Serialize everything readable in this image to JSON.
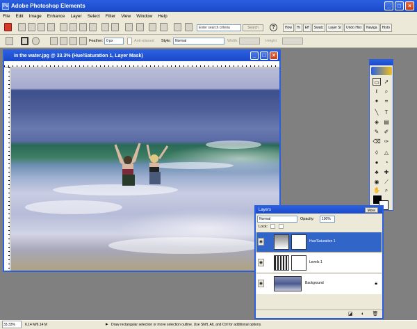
{
  "app": {
    "title": "Adobe Photoshop Elements",
    "icon": "ps-app-icon"
  },
  "window_controls": [
    "minimize-icon",
    "maximize-icon",
    "close-icon"
  ],
  "menu": [
    "File",
    "Edit",
    "Image",
    "Enhance",
    "Layer",
    "Select",
    "Filter",
    "View",
    "Window",
    "Help"
  ],
  "shortcuts": {
    "search_placeholder": "Enter search criteria",
    "search_button": "Search",
    "help_icon": "?",
    "palette_tabs": [
      "How",
      "Hi",
      "Eff",
      "Swatc",
      "Layer St",
      "Undo Hist",
      "Naviga",
      "Histo"
    ]
  },
  "options": {
    "feather_label": "Feather:",
    "feather_value": "0 px",
    "antialias_label": "Anti-aliased",
    "style_label": "Style:",
    "style_value": "Normal",
    "width_label": "Width:",
    "height_label": "Height:"
  },
  "document": {
    "title": "in the water.jpg @ 33.3% (Hue/Saturation 1, Layer Mask)",
    "colors": {
      "sky": "#b9bdd6",
      "sea": "#4d5e97",
      "wave": "#2a6a58",
      "foam": "#c9cde3",
      "sand": "#b0a382"
    }
  },
  "layers": {
    "tab": "Layers",
    "more": "More",
    "blend_mode": "Normal",
    "opacity_label": "Opacity:",
    "opacity_value": "100%",
    "lock_label": "Lock:",
    "rows": [
      {
        "name": "Hue/Saturation 1",
        "selected": true
      },
      {
        "name": "Levels 1",
        "selected": false
      },
      {
        "name": "Background",
        "selected": false
      }
    ]
  },
  "status": {
    "zoom": "33.33%",
    "doc_size": "6.14 M/6.14 M",
    "hint": "Draw rectangular selection or move selection outline. Use Shift, Alt, and Ctrl for additional options."
  }
}
